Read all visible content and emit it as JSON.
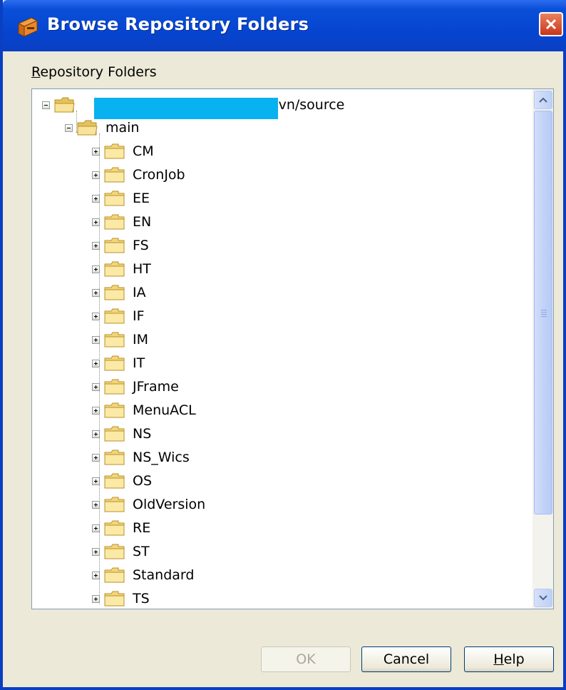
{
  "window": {
    "title": "Browse Repository Folders",
    "title_icon": "svn-repository-icon",
    "close_icon": "close-icon"
  },
  "label": {
    "text_u": "R",
    "text_rest": "epository Folders"
  },
  "tree": {
    "root": {
      "label": "l/svn/source",
      "expanded": true,
      "note": "host portion redacted by blue box"
    },
    "main": {
      "label": "main",
      "expanded": true
    },
    "children": [
      "CM",
      "CronJob",
      "EE",
      "EN",
      "FS",
      "HT",
      "IA",
      "IF",
      "IM",
      "IT",
      "JFrame",
      "MenuACL",
      "NS",
      "NS_Wics",
      "OS",
      "OldVersion",
      "RE",
      "ST",
      "Standard",
      "TS"
    ]
  },
  "buttons": {
    "ok": "OK",
    "cancel": "Cancel",
    "help_u": "H",
    "help_rest": "elp"
  },
  "colors": {
    "accent_title": "#0a4fd8",
    "redaction": "#08b1ef",
    "dialog_bg": "#ece9d8"
  }
}
